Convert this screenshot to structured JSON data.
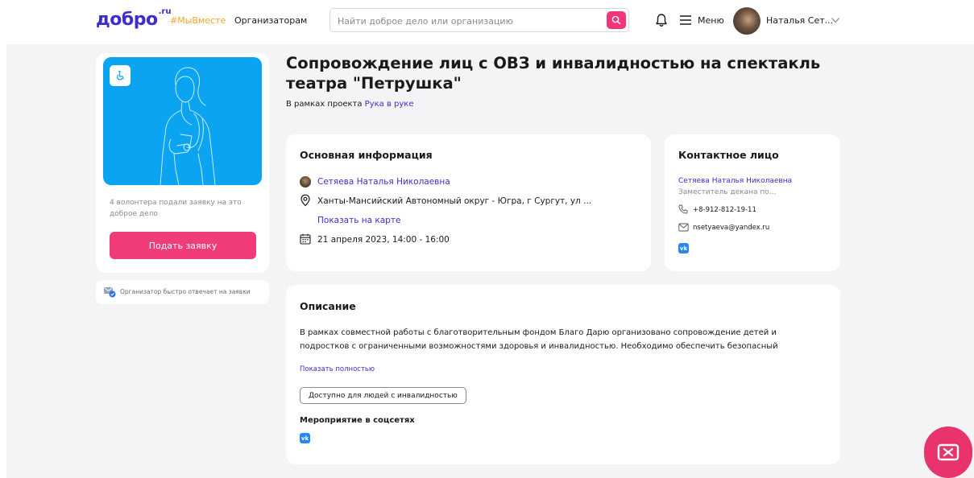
{
  "header": {
    "logo_text": "добро",
    "logo_suffix": ".ru",
    "nav_hashtag": "#МыВместе",
    "nav_organizers": "Организаторам",
    "search_placeholder": "Найти доброе дело или организацию",
    "menu_label": "Меню",
    "user_name": "Наталья Сет...",
    "icons": [
      "search-icon",
      "bell-icon",
      "menu-icon",
      "chevron-down-icon"
    ]
  },
  "sidebar": {
    "volunteers_text": "4 волонтера подали заявку на это доброе дело",
    "apply_button": "Подать заявку",
    "fast_response_text": "Организатор быстро отвечает на заявки"
  },
  "event": {
    "title": "Сопровождение лиц с ОВЗ и инвалидностью на спектакль театра \"Петрушка\"",
    "project_prefix": "В рамках проекта",
    "project_link": "Рука в руке"
  },
  "main_info": {
    "heading": "Основная информация",
    "organizer_name": "Сетяева Наталья Николаевна",
    "address": "Ханты-Мансийский Автономный округ - Югра, г Сургут, ул ...",
    "map_link": "Показать на карте",
    "date": "21 апреля 2023, 14:00 - 16:00"
  },
  "contact": {
    "heading": "Контактное лицо",
    "name": "Сетяева Наталья Николаевна",
    "role": "Заместитель декана по...",
    "phone": "+8-912-812-19-11",
    "email": "nsetyaeva@yandex.ru",
    "vk_label": "vk"
  },
  "description": {
    "heading": "Описание",
    "text": "В рамках совместной работы с благотворительным фондом Благо Дарю организовано сопровождение детей и подростков с ограниченными возможностями здоровья и инвалидностью. Необходимо обеспечить безопасный",
    "show_more": "Показать полностью",
    "tag": "Доступно для людей с инвалидностью",
    "social_heading": "Мероприятие в соцсетях",
    "vk_label": "vk"
  },
  "colors": {
    "brand": "#3b2ecf",
    "accent_pink": "#f03d7a",
    "hashtag": "#f5a623",
    "hero_blue": "#0ba4f1",
    "vk_blue": "#2787f5",
    "page_bg": "#f4f4f6"
  }
}
